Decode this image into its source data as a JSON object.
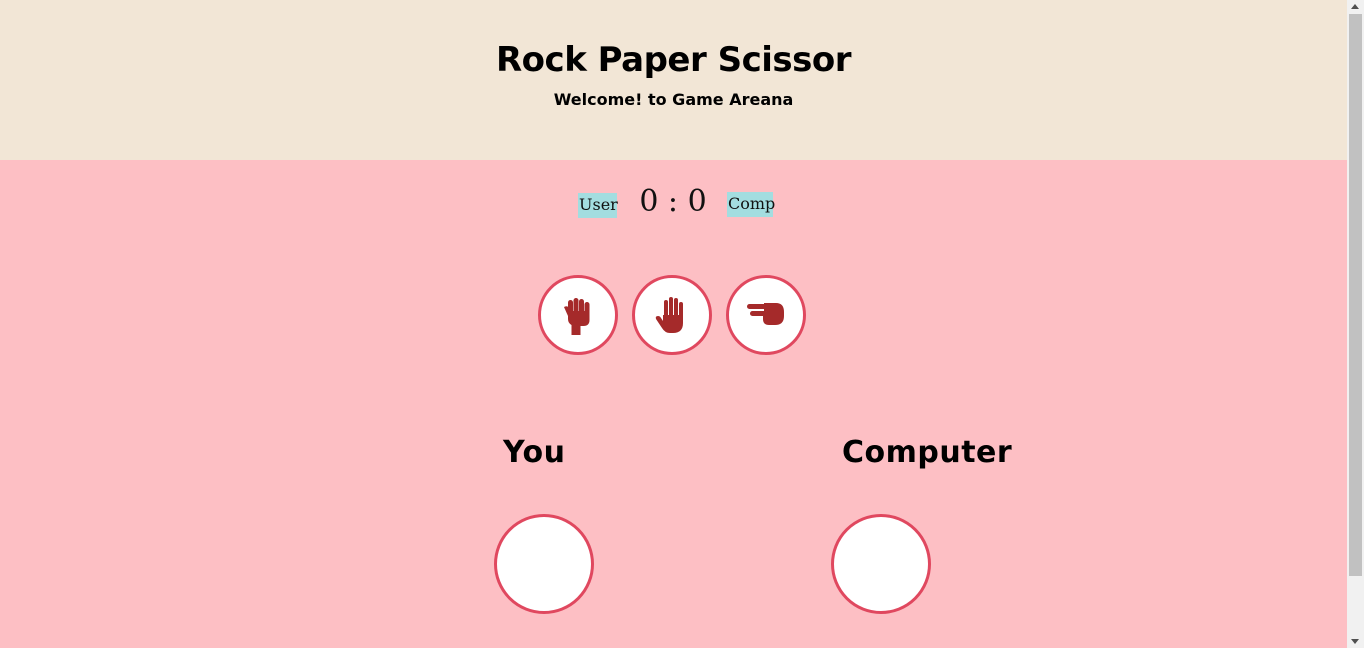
{
  "header": {
    "title": "Rock Paper Scissor",
    "subtitle": "Welcome! to Game Areana"
  },
  "scoreboard": {
    "user_label": "User",
    "score": "0 : 0",
    "comp_label": "Comp"
  },
  "choices": [
    {
      "name": "rock",
      "icon": "rock-hand-icon"
    },
    {
      "name": "paper",
      "icon": "paper-hand-icon"
    },
    {
      "name": "scissor",
      "icon": "scissor-hand-icon"
    }
  ],
  "players": {
    "you_label": "You",
    "computer_label": "Computer"
  },
  "colors": {
    "header_bg": "#f2e6d6",
    "main_bg": "#fdbfc4",
    "accent_border": "#e0485f",
    "icon_color": "#a52a2a",
    "score_tag_bg": "#a3dde0"
  }
}
